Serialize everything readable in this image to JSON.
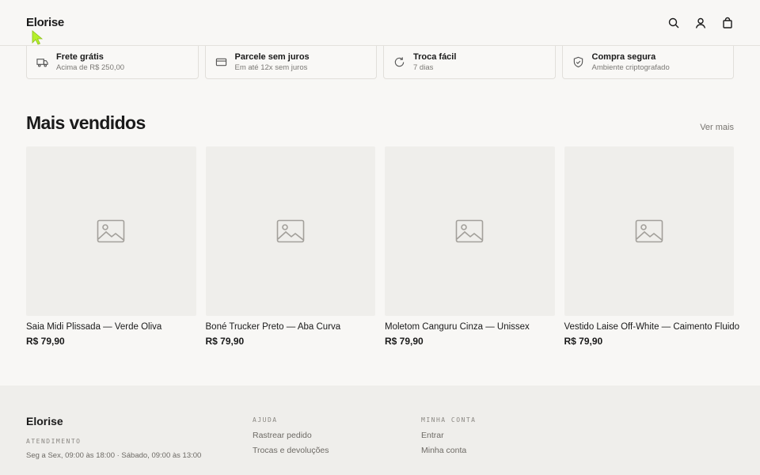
{
  "header": {
    "logo": "Elorise",
    "icons": [
      "search-icon",
      "user-icon",
      "bag-icon"
    ]
  },
  "benefits": [
    {
      "title": "Frete grátis",
      "subtitle": "Acima de R$ 250,00",
      "icon": "truck-icon"
    },
    {
      "title": "Parcele sem juros",
      "subtitle": "Em até 12x sem juros",
      "icon": "credit-card-icon"
    },
    {
      "title": "Troca fácil",
      "subtitle": "7 dias",
      "icon": "refresh-icon"
    },
    {
      "title": "Compra segura",
      "subtitle": "Ambiente criptografado",
      "icon": "shield-check-icon"
    }
  ],
  "bestsellers": {
    "title": "Mais vendidos",
    "see_more": "Ver mais",
    "products": [
      {
        "name": "Saia Midi Plissada — Verde Oliva",
        "price": "R$ 79,90"
      },
      {
        "name": "Boné Trucker Preto — Aba Curva",
        "price": "R$ 79,90"
      },
      {
        "name": "Moletom Canguru Cinza — Unissex",
        "price": "R$ 79,90"
      },
      {
        "name": "Vestido Laise Off-White — Caimento Fluido",
        "price": "R$ 79,90"
      }
    ]
  },
  "footer": {
    "logo": "Elorise",
    "service_label": "ATENDIMENTO",
    "hours": "Seg a Sex, 09:00 às 18:00 · Sábado, 09:00 às 13:00",
    "help": {
      "label": "AJUDA",
      "links": [
        "Rastrear pedido",
        "Trocas e devoluções"
      ]
    },
    "account": {
      "label": "MINHA CONTA",
      "links": [
        "Entrar",
        "Minha conta"
      ]
    }
  },
  "colors": {
    "background": "#f8f7f5",
    "footer": "#efeeeb",
    "cursor": "#b5f02a"
  }
}
